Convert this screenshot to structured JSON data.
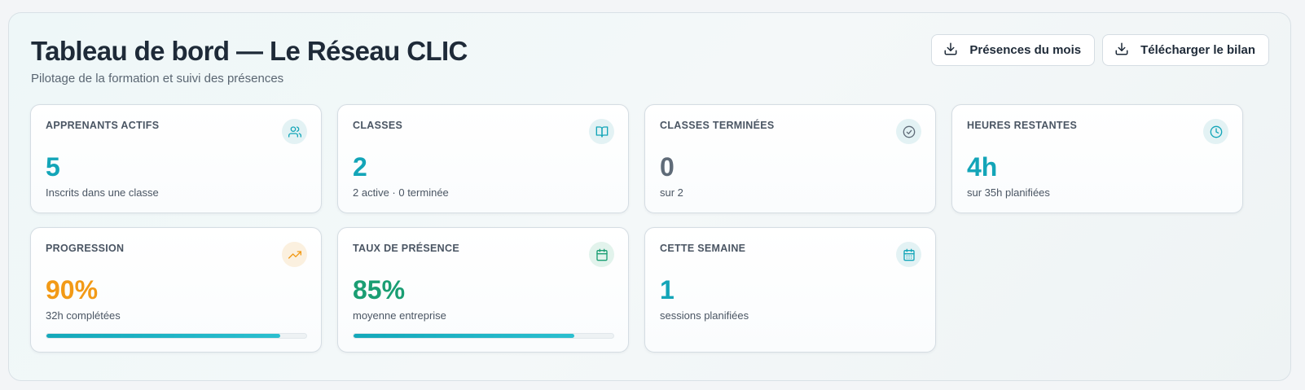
{
  "header": {
    "title": "Tableau de bord — Le Réseau CLIC",
    "subtitle": "Pilotage de la formation et suivi des présences"
  },
  "actions": {
    "attendance_label": "Présences du mois",
    "report_label": "Télécharger le bilan"
  },
  "colors": {
    "teal": "#13a5b8",
    "slate": "#5f6b78",
    "orange": "#f29a16",
    "green": "#1a9e73"
  },
  "cards": [
    {
      "label": "APPRENANTS ACTIFS",
      "value": "5",
      "desc": "Inscrits dans une classe",
      "icon": "users-icon"
    },
    {
      "label": "CLASSES",
      "value": "2",
      "desc": "2 active · 0 terminée",
      "icon": "book-open-icon"
    },
    {
      "label": "CLASSES TERMINÉES",
      "value": "0",
      "desc": "sur 2",
      "icon": "check-circle-icon"
    },
    {
      "label": "HEURES RESTANTES",
      "value": "4h",
      "desc": "sur 35h planifiées",
      "icon": "clock-icon"
    },
    {
      "label": "PROGRESSION",
      "value": "90%",
      "desc": "32h complétées",
      "icon": "trending-up-icon",
      "progress": 0.9
    },
    {
      "label": "TAUX DE PRÉSENCE",
      "value": "85%",
      "desc": "moyenne entreprise",
      "icon": "calendar-check-icon",
      "progress": 0.85
    },
    {
      "label": "CETTE SEMAINE",
      "value": "1",
      "desc": "sessions planifiées",
      "icon": "calendar-icon"
    }
  ]
}
